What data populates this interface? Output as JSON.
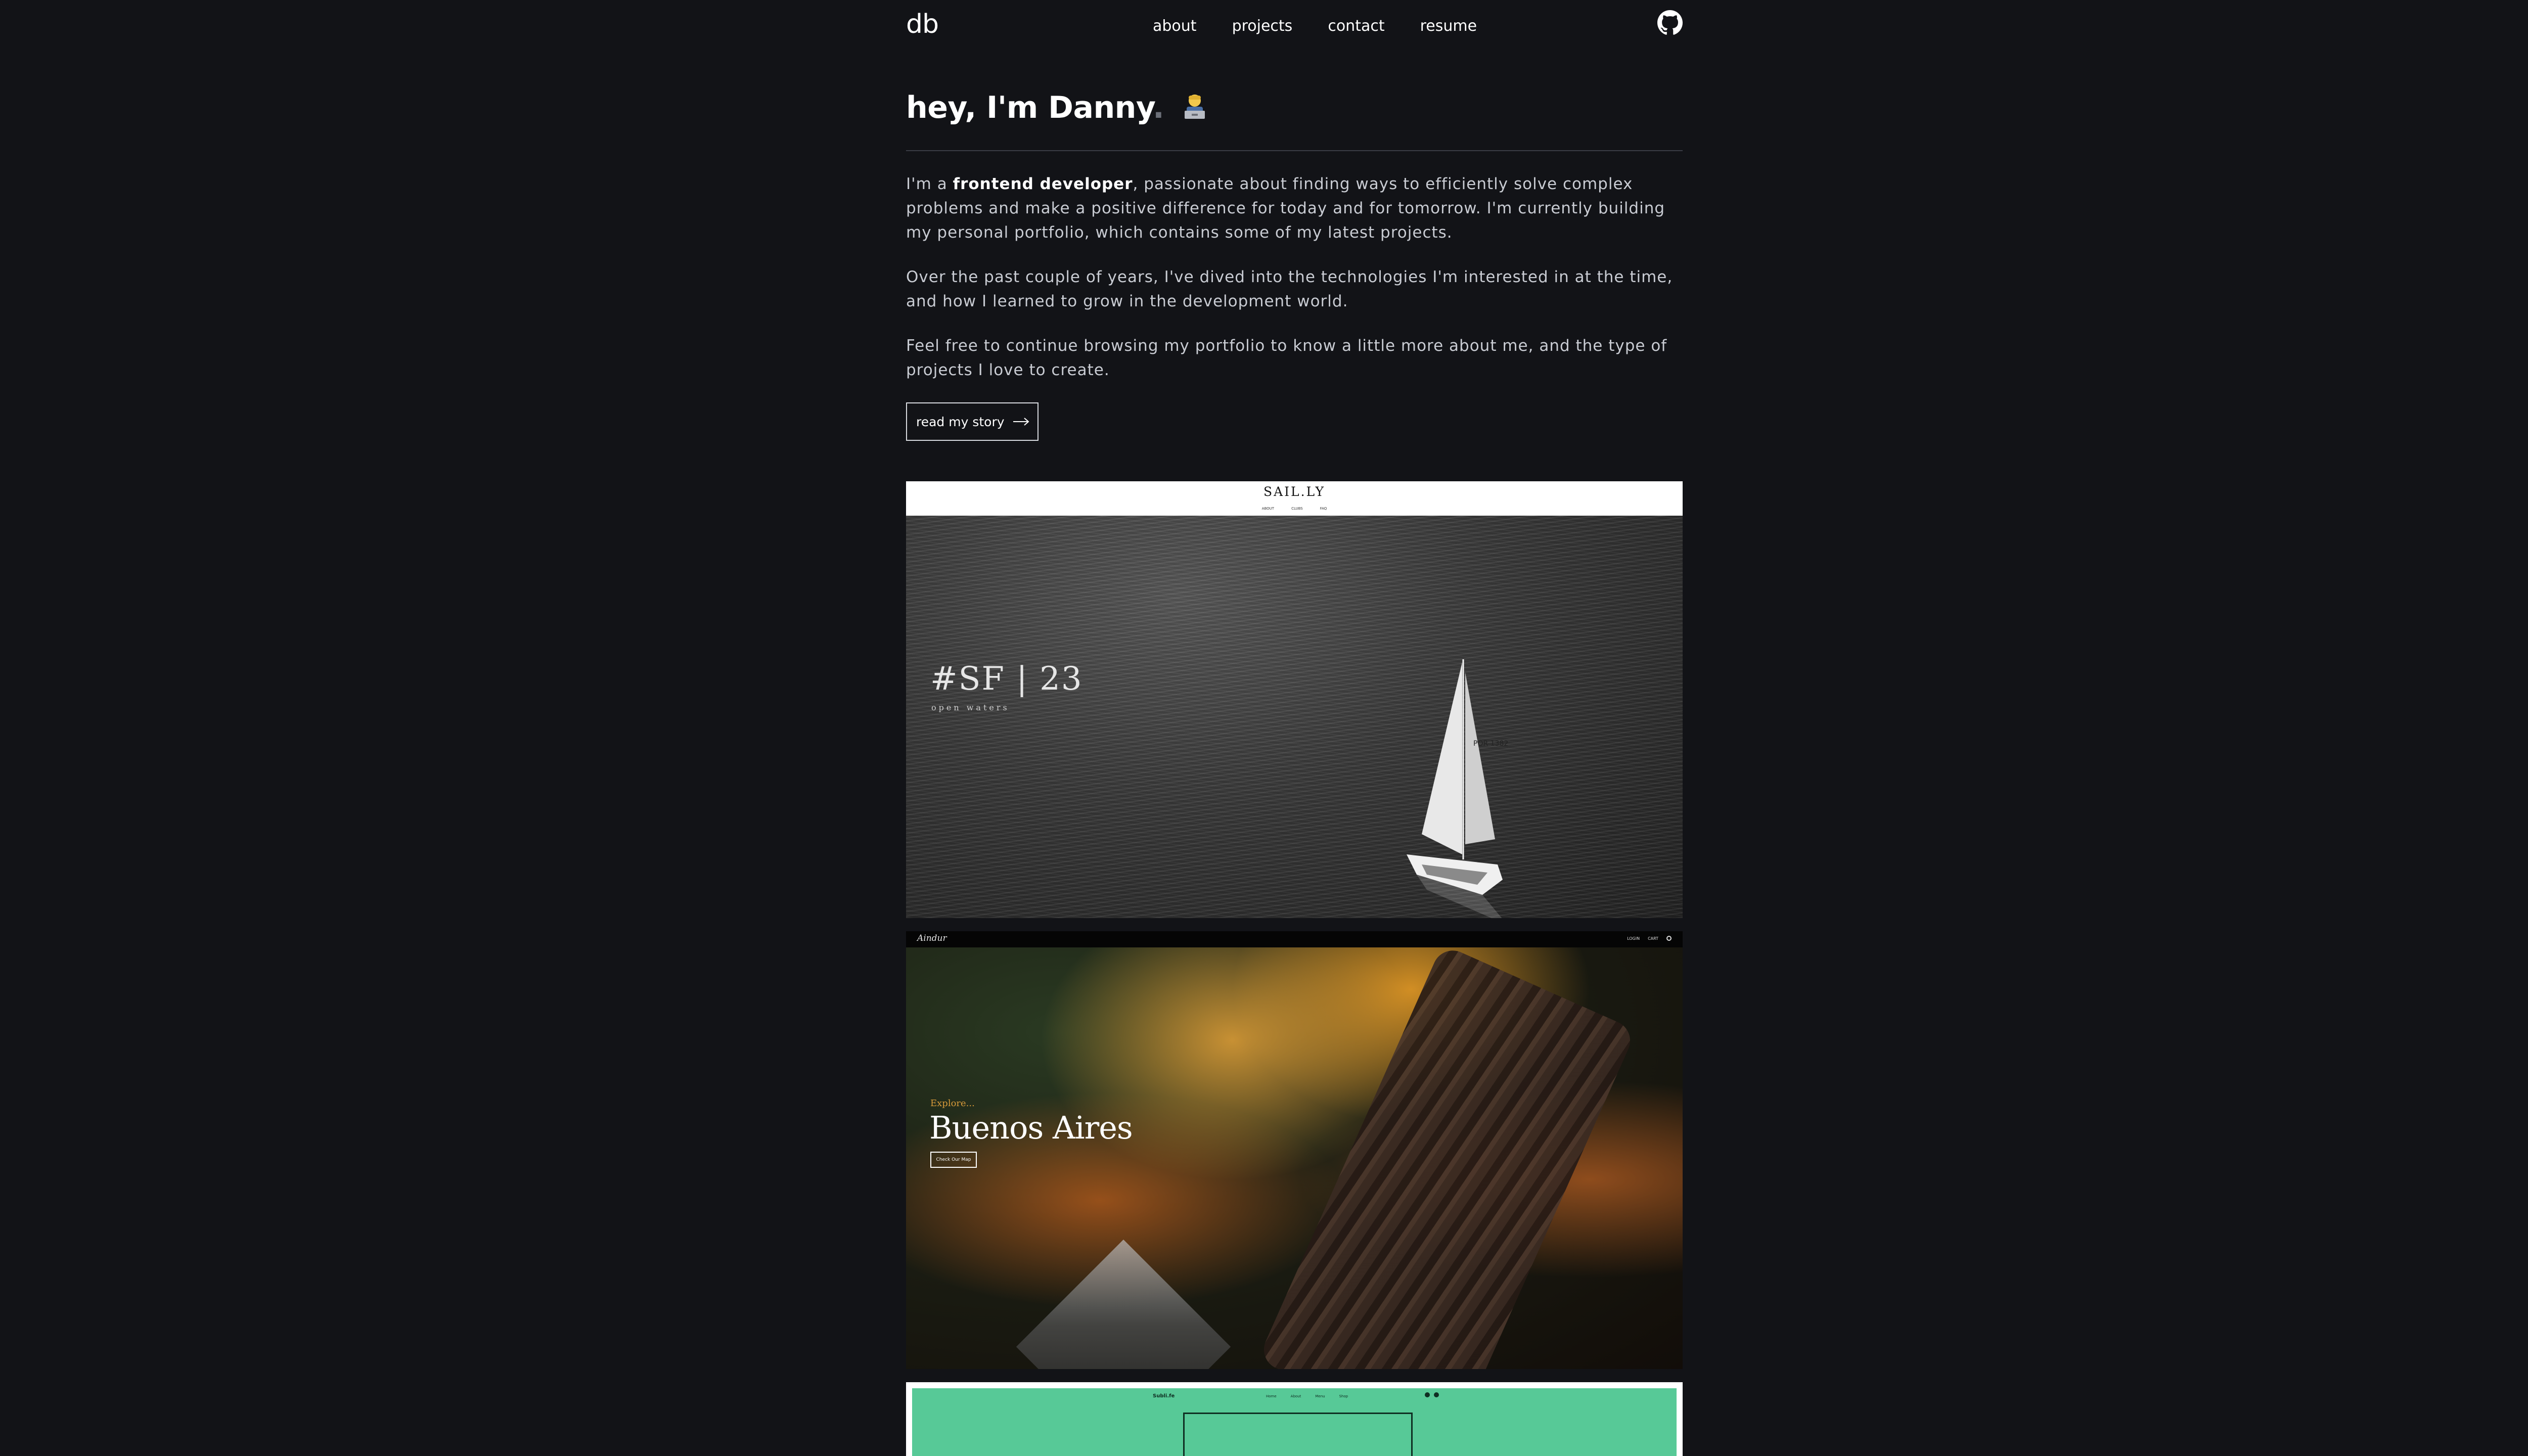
{
  "nav": {
    "logo": "db",
    "links": [
      "about",
      "projects",
      "contact",
      "resume"
    ],
    "github_icon": "github-icon"
  },
  "hero": {
    "greeting": "hey, I'm Danny",
    "dot": ".",
    "emoji_icon": "person-with-laptop-icon",
    "para1_prefix": "I'm a ",
    "para1_bold": "frontend developer",
    "para1_rest": ", passionate about finding ways to efficiently solve complex problems and make a positive difference for today and for tomorrow. I'm currently building my personal portfolio, which contains some of my latest projects.",
    "para2": "Over the past couple of years, I've dived into the technologies I'm interested in at the time, and how I learned to grow in the development world.",
    "para3": "Feel free to continue browsing my portfolio to know a little more about me, and the type of projects I love to create.",
    "story_button": "read my story"
  },
  "projects": [
    {
      "brand": "SAIL.LY",
      "menu": [
        "ABOUT",
        "CLUBS",
        "FAQ"
      ],
      "headline": "#SF | 23",
      "subline": "open waters",
      "boat_sail_text": "POR 1382"
    },
    {
      "logo": "Aindur",
      "menu": [
        "LOGIN",
        "CART"
      ],
      "kicker": "Explore...",
      "headline": "Buenos Aires",
      "button": "Check Our Map"
    },
    {
      "brand": "Subli.fe",
      "menu": [
        "Home",
        "About",
        "Menu",
        "Shop"
      ]
    }
  ],
  "colors": {
    "background": "#121317",
    "text": "#cfd2d8",
    "heading": "#ffffff",
    "card3_green": "#57c997"
  }
}
